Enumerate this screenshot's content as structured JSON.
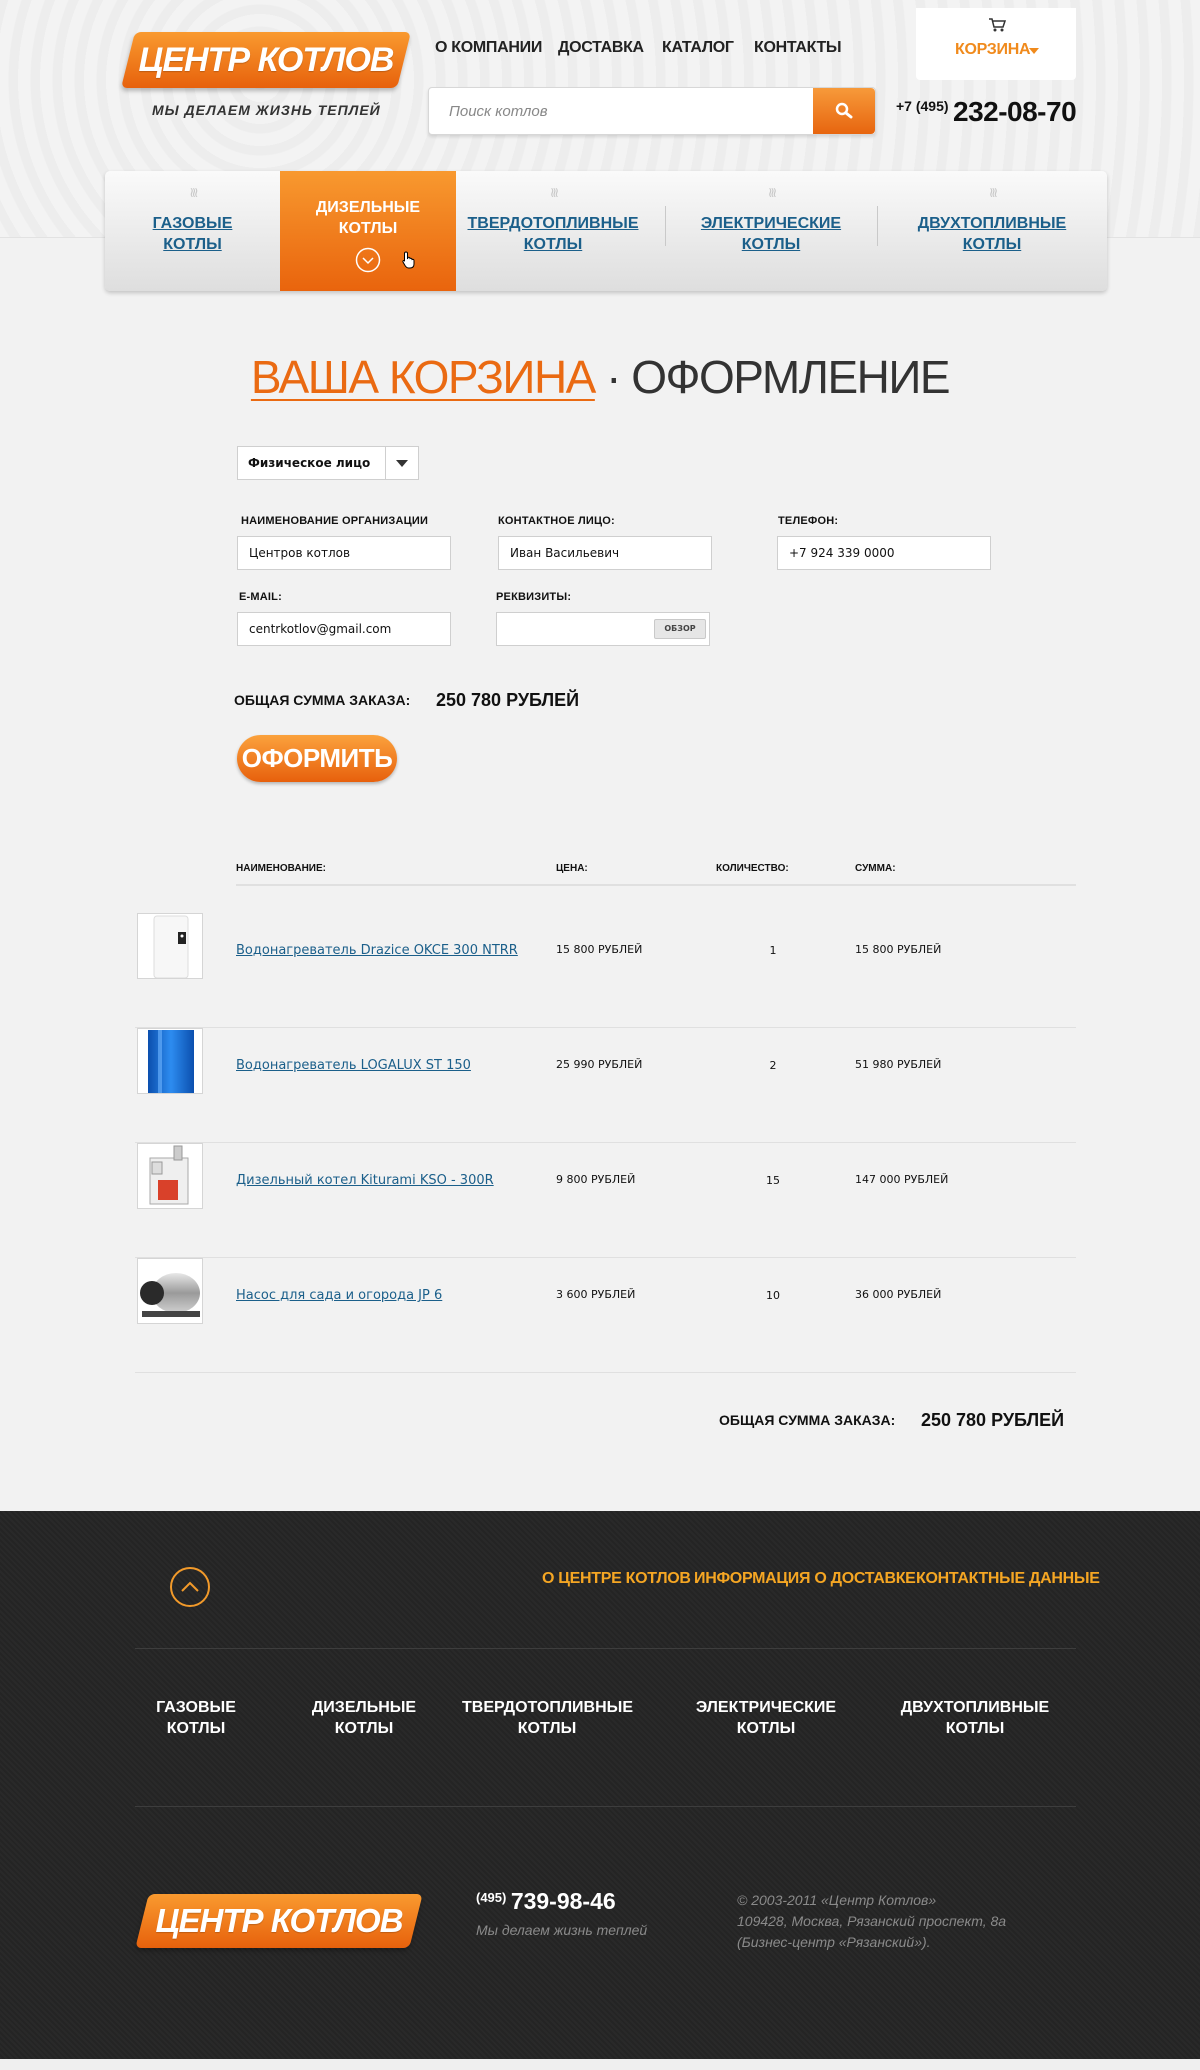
{
  "brand": {
    "logo_text": "ЦЕНТР КОТЛОВ",
    "tagline": "МЫ ДЕЛАЕМ ЖИЗНЬ ТЕПЛЕЙ",
    "accent": "#ea6a12",
    "link_color": "#1b5f8a"
  },
  "topnav": [
    "О КОМПАНИИ",
    "ДОСТАВКА",
    "КАТАЛОГ",
    "КОНТАКТЫ"
  ],
  "search": {
    "placeholder": "Поиск котлов",
    "icon": "search-icon"
  },
  "cart": {
    "label": "КОРЗИНА",
    "icon": "cart-icon"
  },
  "phone": {
    "code": "+7 (495)",
    "number": "232-08-70"
  },
  "categories": [
    {
      "line1": "ГАЗОВЫЕ",
      "line2": "КОТЛЫ",
      "active": false
    },
    {
      "line1": "ДИЗЕЛЬНЫЕ",
      "line2": "КОТЛЫ",
      "active": true
    },
    {
      "line1": "ТВЕРДОТОПЛИВНЫЕ",
      "line2": "КОТЛЫ",
      "active": false
    },
    {
      "line1": "ЭЛЕКТРИЧЕСКИЕ",
      "line2": "КОТЛЫ",
      "active": false
    },
    {
      "line1": "ДВУХТОПЛИВНЫЕ",
      "line2": "КОТЛЫ",
      "active": false
    }
  ],
  "page_title": {
    "link": "ВАША КОРЗИНА",
    "separator": "·",
    "current": "ОФОРМЛЕНИЕ"
  },
  "form": {
    "person_type": "Физическое лицо",
    "org_label": "НАИМЕНОВАНИЕ ОРГАНИЗАЦИИ",
    "org_value": "Центров котлов",
    "contact_label": "КОНТАКТНОЕ ЛИЦО:",
    "contact_value": "Иван Васильевич",
    "phone_label": "ТЕЛЕФОН:",
    "phone_value": "+7 924 339 0000",
    "email_label": "E-MAIL:",
    "email_value": "centrkotlov@gmail.com",
    "requisites_label": "РЕКВИЗИТЫ:",
    "browse_label": "ОБЗОР",
    "total_label": "ОБЩАЯ СУММА ЗАКАЗА:",
    "total_value": "250 780 РУБЛЕЙ",
    "submit_label": "ОФОРМИТЬ"
  },
  "table": {
    "headers": [
      "НАИМЕНОВАНИЕ:",
      "ЦЕНА:",
      "КОЛИЧЕСТВО:",
      "СУММА:"
    ],
    "rows": [
      {
        "name": "Водонагреватель Drazice OKCE 300 NTRR",
        "price": "15 800 РУБЛЕЙ",
        "qty": "1",
        "sum": "15 800 РУБЛЕЙ"
      },
      {
        "name": "Водонагреватель LOGALUX ST 150",
        "price": "25 990 РУБЛЕЙ",
        "qty": "2",
        "sum": "51 980 РУБЛЕЙ"
      },
      {
        "name": "Дизельный котел Kiturami KSO - 300R",
        "price": "9 800 РУБЛЕЙ",
        "qty": "15",
        "sum": "147 000 РУБЛЕЙ"
      },
      {
        "name": "Насос для сада и огорода JP 6",
        "price": "3 600 РУБЛЕЙ",
        "qty": "10",
        "sum": "36 000 РУБЛЕЙ"
      }
    ],
    "total_label": "ОБЩАЯ СУММА ЗАКАЗА:",
    "total_value": "250 780 РУБЛЕЙ"
  },
  "footer": {
    "links": [
      "О ЦЕНТРЕ КОТЛОВ",
      "ИНФОРМАЦИЯ О ДОСТАВКЕ",
      "КОНТАКТНЫЕ ДАННЫЕ"
    ],
    "categories": [
      {
        "line1": "ГАЗОВЫЕ",
        "line2": "КОТЛЫ"
      },
      {
        "line1": "ДИЗЕЛЬНЫЕ",
        "line2": "КОТЛЫ"
      },
      {
        "line1": "ТВЕРДОТОПЛИВНЫЕ",
        "line2": "КОТЛЫ"
      },
      {
        "line1": "ЭЛЕКТРИЧЕСКИЕ",
        "line2": "КОТЛЫ"
      },
      {
        "line1": "ДВУХТОПЛИВНЫЕ",
        "line2": "КОТЛЫ"
      }
    ],
    "logo_text": "ЦЕНТР КОТЛОВ",
    "phone_code": "(495)",
    "phone_number": "739-98-46",
    "tagline": "Мы делаем жизнь теплей",
    "copyright": [
      "© 2003-2011 «Центр Котлов»",
      "109428, Москва, Рязанский проспект, 8а",
      "(Бизнес-центр «Рязанский»)."
    ]
  }
}
